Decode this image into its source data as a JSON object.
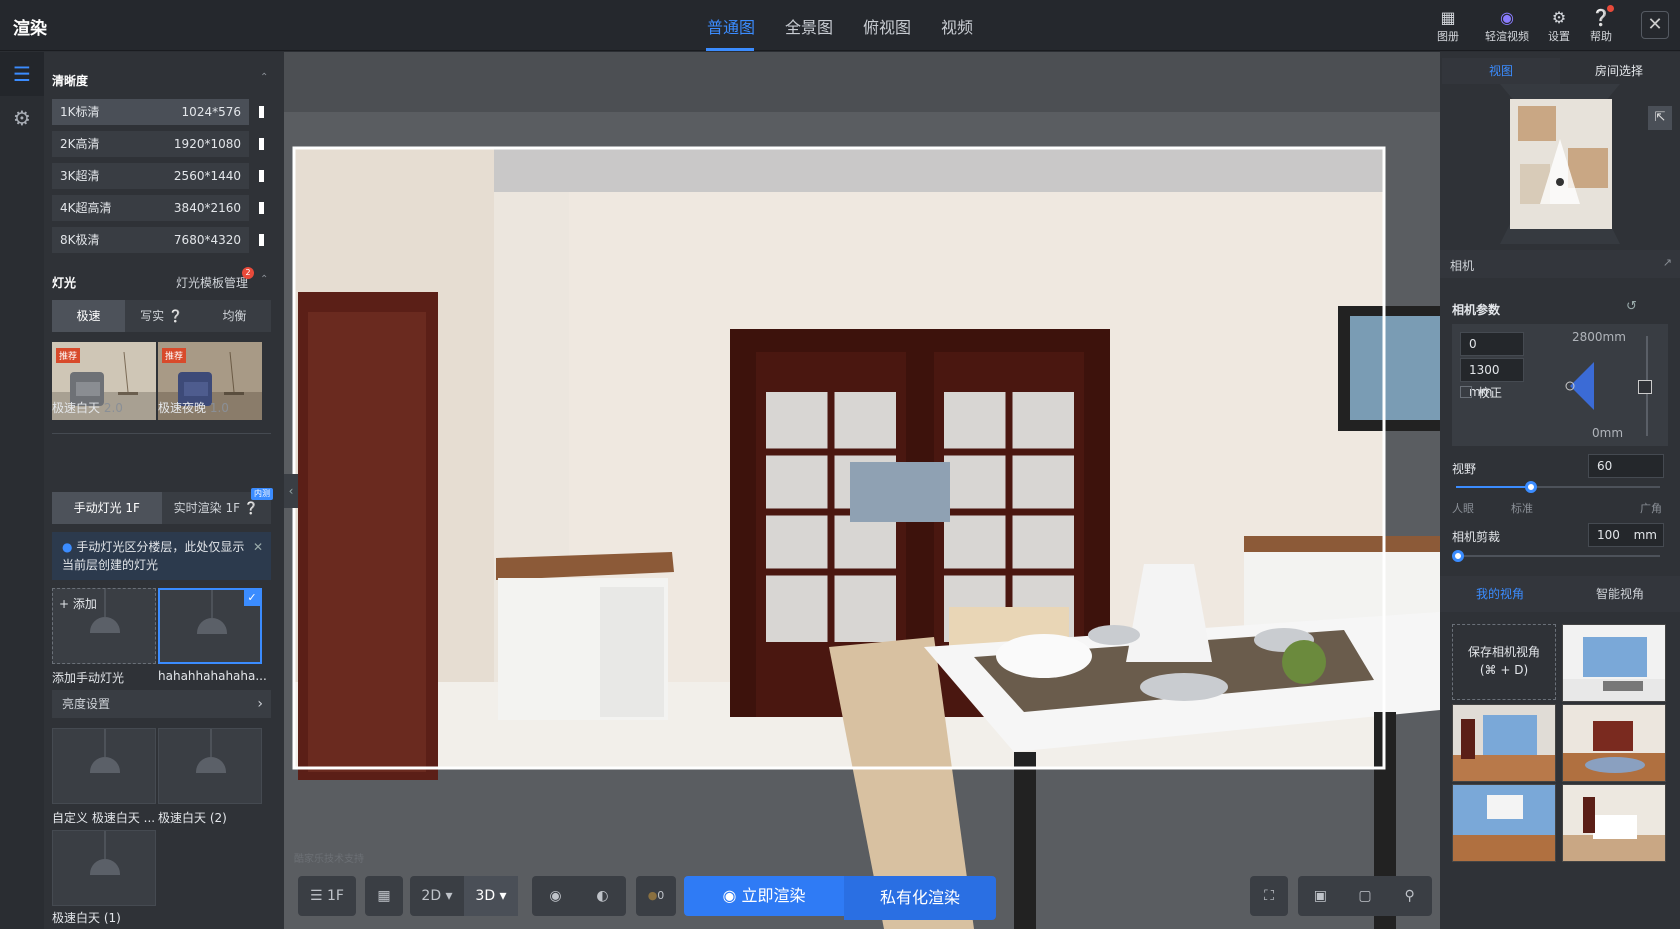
{
  "app": {
    "title": "渲染"
  },
  "tabs": [
    {
      "label": "普通图",
      "active": true
    },
    {
      "label": "全景图",
      "active": false
    },
    {
      "label": "俯视图",
      "active": false
    },
    {
      "label": "视频",
      "active": false
    }
  ],
  "toolbar": {
    "album": "图册",
    "quick_video": "轻渲视频",
    "settings": "设置",
    "help": "帮助",
    "close_icon": "close-icon"
  },
  "left": {
    "clarity": {
      "title": "清晰度",
      "items": [
        {
          "label": "1K标清",
          "value": "1024*576",
          "selected": true
        },
        {
          "label": "2K高清",
          "value": "1920*1080"
        },
        {
          "label": "3K超清",
          "value": "2560*1440"
        },
        {
          "label": "4K超高清",
          "value": "3840*2160"
        },
        {
          "label": "8K极清",
          "value": "7680*4320"
        }
      ]
    },
    "light": {
      "title": "灯光",
      "template_mgr": "灯光模板管理",
      "badge": "2",
      "modes": [
        "极速",
        "写实",
        "均衡"
      ],
      "presets": [
        {
          "tag": "推荐",
          "name": "极速白天",
          "ver": "2.0"
        },
        {
          "tag": "推荐",
          "name": "极速夜晚",
          "ver": "1.0"
        }
      ],
      "tabs": [
        "手动灯光 1F",
        "实时渲染 1F"
      ],
      "beta": "内测",
      "notice": "手动灯光区分楼层，此处仅显示当前层创建的灯光",
      "add_label": "添加",
      "lamps": [
        "添加手动灯光",
        "hahahhahahaha...",
        "自定义 极速白天 ...",
        "极速白天 (2)",
        "极速白天 (1)"
      ],
      "brightness": "亮度设置"
    }
  },
  "viewport": {
    "floor": "1F",
    "view2d": "2D",
    "view3d": "3D",
    "light_count": "0",
    "render_now": "立即渲染",
    "private_render": "私有化渲染",
    "watermark": "酷家乐技术支持"
  },
  "right": {
    "tabs": [
      "视图",
      "房间选择"
    ],
    "camera_title": "相机",
    "camera_params": "相机参数",
    "angle": "0",
    "height": "1300 mm",
    "correct": "校正",
    "top_mm": "2800mm",
    "bottom_mm": "0mm",
    "fov_label": "视野",
    "fov_value": "60",
    "fov_ticks": [
      "人眼",
      "标准",
      "广角"
    ],
    "fov_percent": 0.37,
    "clip_label": "相机剪裁",
    "clip_value": "100",
    "clip_unit": "mm",
    "view_tabs": [
      "我的视角",
      "智能视角"
    ],
    "save_view": "保存相机视角",
    "save_shortcut": "(⌘ + D)"
  },
  "colors": {
    "accent": "#3b8cff",
    "panel": "#2f3237",
    "render_btn": "#2f7bf5"
  }
}
